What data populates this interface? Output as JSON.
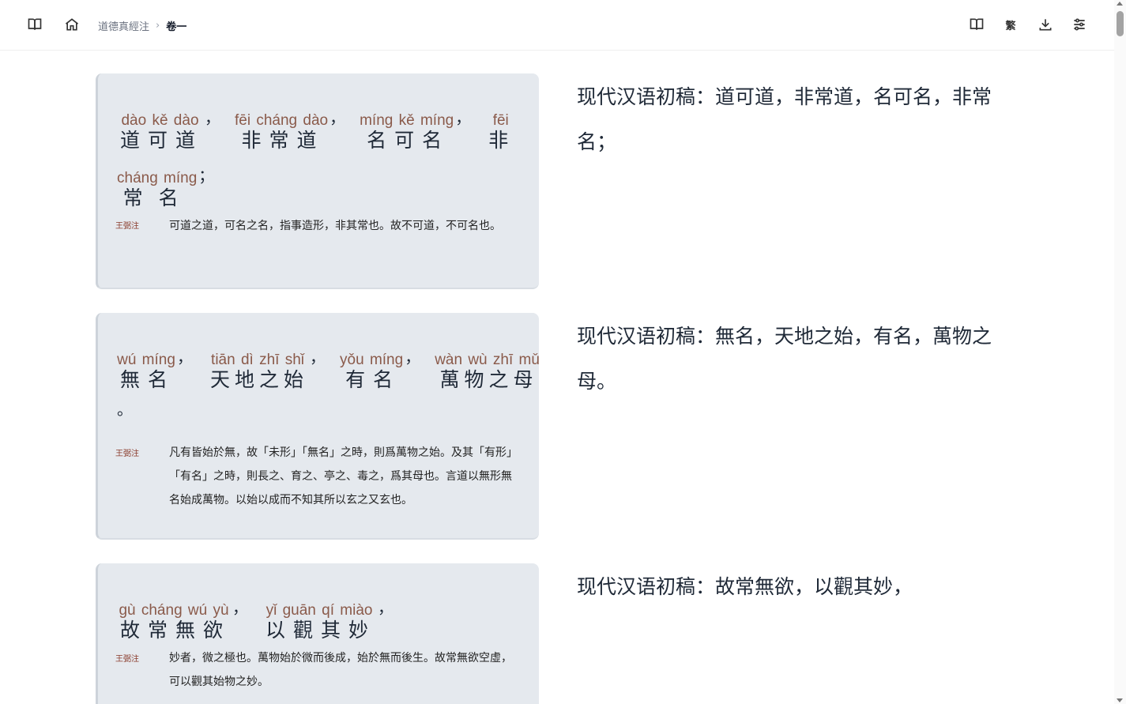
{
  "breadcrumb": {
    "book": "道德真經注",
    "separator": "›",
    "current": "卷一"
  },
  "toolbar": {
    "script_toggle": "繁"
  },
  "icons": {
    "left": [
      "book-icon",
      "home-icon"
    ],
    "right": [
      "book-icon",
      "traditional-chinese-icon",
      "download-icon",
      "settings-sliders-icon"
    ]
  },
  "verses": [
    {
      "lines": [
        {
          "words": [
            {
              "py": "dào kě dào",
              "hz": "道可道",
              "punct": "，"
            },
            {
              "py": "fēi cháng dào",
              "hz": "非常道",
              "punct": "，"
            },
            {
              "py": "míng kě míng",
              "hz": "名可名",
              "punct": "，"
            },
            {
              "py": "fēi",
              "hz": "非",
              "punct": ""
            }
          ]
        },
        {
          "words": [
            {
              "py": "cháng míng",
              "hz": "常名",
              "punct": "；"
            }
          ]
        }
      ],
      "note_label": "王弼注",
      "note_text": "可道之道，可名之名，指事造形，非其常也。故不可道，不可名也。",
      "translation": "现代汉语初稿：道可道，非常道，名可名，非常名；"
    },
    {
      "lines": [
        {
          "words": [
            {
              "py": "wú míng",
              "hz": "無名",
              "punct": "，"
            },
            {
              "py": "tiān dì zhī shǐ",
              "hz": "天地之始",
              "punct": "，"
            },
            {
              "py": "yǒu míng",
              "hz": "有名",
              "punct": "，"
            },
            {
              "py": "wàn wù zhī mǔ",
              "hz": "萬物之母",
              "punct": ""
            }
          ]
        }
      ],
      "trailing_punct": "。",
      "note_label": "王弼注",
      "note_text": "凡有皆始於無，故「未形」「無名」之時，則爲萬物之始。及其「有形」「有名」之時，則長之、育之、亭之、毒之，爲其母也。言道以無形無名始成萬物。以始以成而不知其所以玄之又玄也。",
      "translation": "现代汉语初稿：無名，天地之始，有名，萬物之母。"
    },
    {
      "lines": [
        {
          "words": [
            {
              "py": "gù cháng wú yù",
              "hz": "故常無欲",
              "punct": "，"
            },
            {
              "py": "yǐ guān qí miào",
              "hz": "以觀其妙",
              "punct": "，"
            }
          ]
        }
      ],
      "note_label": "王弼注",
      "note_text": "妙者，微之極也。萬物始於微而後成，始於無而後生。故常無欲空虛，可以觀其始物之妙。",
      "translation": "现代汉语初稿：故常無欲，以觀其妙，"
    }
  ]
}
